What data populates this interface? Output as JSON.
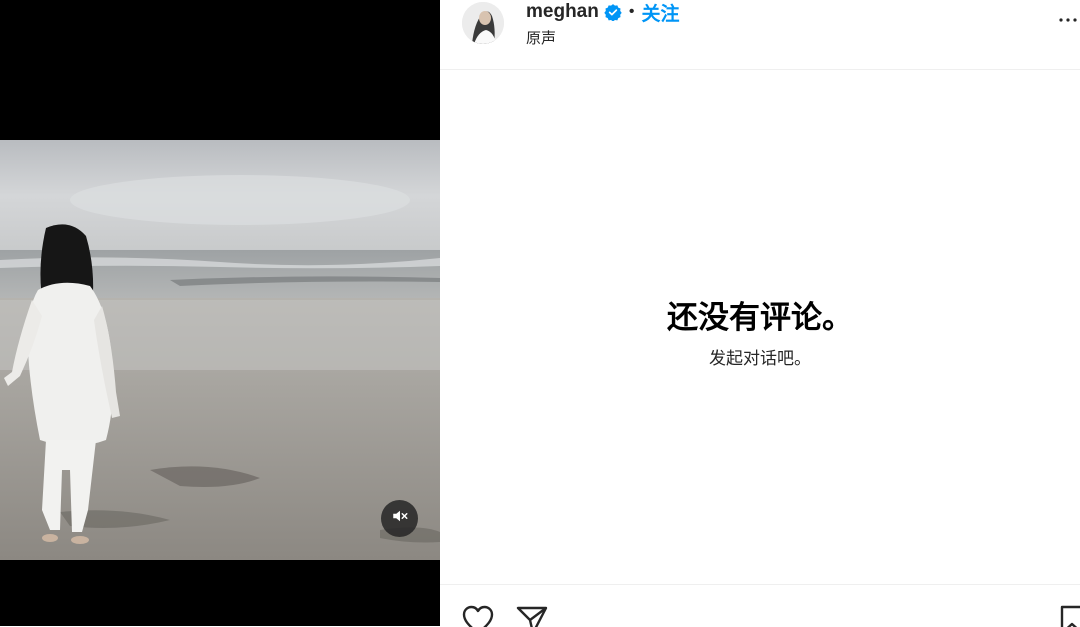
{
  "media": {
    "mute_icon": "speaker-muted-icon"
  },
  "post": {
    "username": "meghan",
    "verified_icon": "verified-badge-icon",
    "separator": "•",
    "follow_label": "关注",
    "audio_label": "原声",
    "more_icon": "more-options-icon"
  },
  "comments": {
    "empty_title": "还没有评论。",
    "empty_subtitle": "发起对话吧。"
  },
  "actions": {
    "like_icon": "heart-icon",
    "share_icon": "paper-plane-icon",
    "save_icon": "bookmark-icon"
  },
  "colors": {
    "accent": "#0095f6",
    "text": "#262626",
    "divider": "#efefef",
    "media_bg": "#000000"
  }
}
